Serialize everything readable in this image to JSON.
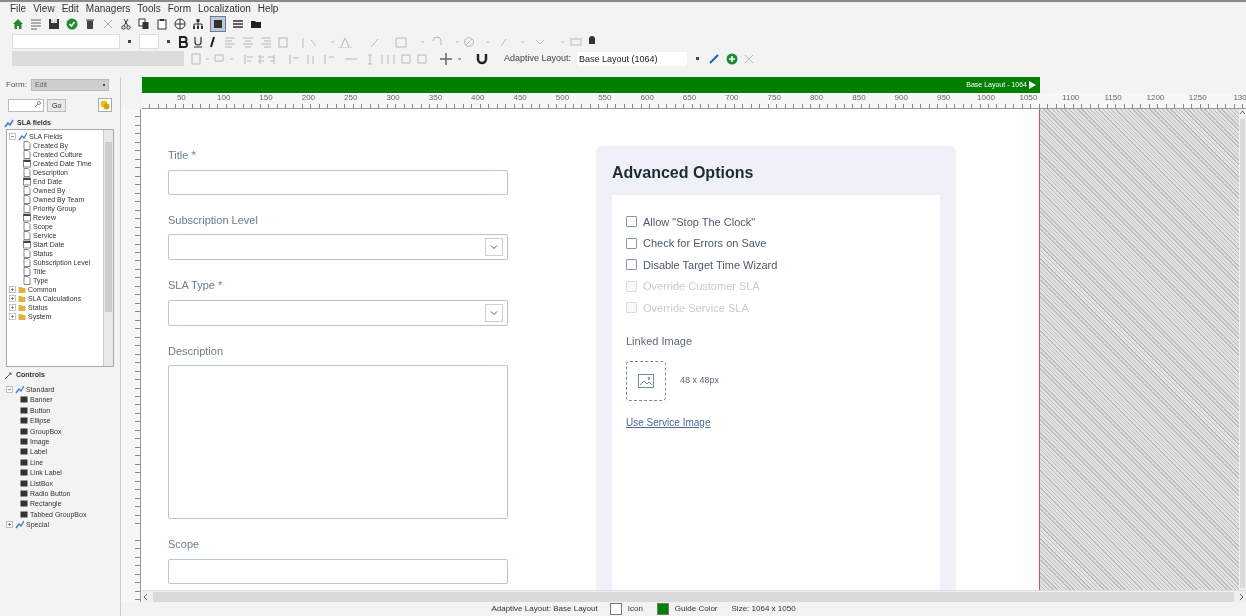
{
  "menu": [
    "File",
    "View",
    "Edit",
    "Managers",
    "Tools",
    "Form",
    "Localization",
    "Help"
  ],
  "toolbar": {
    "adaptive_layout_label": "Adaptive Layout:",
    "adaptive_layout_value": "Base Layout (1064)"
  },
  "left_panel": {
    "form_label": "Form:",
    "form_value": "Edit",
    "go_button": "Go",
    "fields_header": "SLA fields",
    "field_tree": [
      {
        "label": "SLA Fields",
        "kind": "group",
        "expanded": true,
        "children": [
          {
            "label": "Created By",
            "kind": "field"
          },
          {
            "label": "Created Culture",
            "kind": "field"
          },
          {
            "label": "Created Date Time",
            "kind": "date"
          },
          {
            "label": "Description",
            "kind": "field"
          },
          {
            "label": "End Date",
            "kind": "date"
          },
          {
            "label": "Owned By",
            "kind": "field"
          },
          {
            "label": "Owned By Team",
            "kind": "field"
          },
          {
            "label": "Priority Group",
            "kind": "field"
          },
          {
            "label": "Review",
            "kind": "date"
          },
          {
            "label": "Scope",
            "kind": "field"
          },
          {
            "label": "Service",
            "kind": "field"
          },
          {
            "label": "Start Date",
            "kind": "date"
          },
          {
            "label": "Status",
            "kind": "field"
          },
          {
            "label": "Subscription Level",
            "kind": "field"
          },
          {
            "label": "Title",
            "kind": "field"
          },
          {
            "label": "Type",
            "kind": "field"
          }
        ]
      },
      {
        "label": "Common",
        "kind": "folder",
        "expanded": false
      },
      {
        "label": "SLA Calculations",
        "kind": "folder",
        "expanded": false
      },
      {
        "label": "Status",
        "kind": "folder",
        "expanded": false
      },
      {
        "label": "System",
        "kind": "folder",
        "expanded": false
      }
    ],
    "controls_header": "Controls",
    "controls_tree": [
      {
        "label": "Standard",
        "kind": "group",
        "expanded": true,
        "children": [
          {
            "label": "Banner",
            "kind": "control"
          },
          {
            "label": "Button",
            "kind": "control"
          },
          {
            "label": "Ellipse",
            "kind": "control"
          },
          {
            "label": "GroupBox",
            "kind": "control"
          },
          {
            "label": "Image",
            "kind": "control"
          },
          {
            "label": "Label",
            "kind": "control"
          },
          {
            "label": "Line",
            "kind": "control"
          },
          {
            "label": "Link Label",
            "kind": "control"
          },
          {
            "label": "ListBox",
            "kind": "control"
          },
          {
            "label": "Radio Button",
            "kind": "control"
          },
          {
            "label": "Rectangle",
            "kind": "control"
          },
          {
            "label": "Tabbed GroupBox",
            "kind": "control"
          }
        ]
      },
      {
        "label": "Special",
        "kind": "group",
        "expanded": false
      }
    ]
  },
  "canvas": {
    "layout_banner": "Base Layout - 1064",
    "ruler_labels": [
      "50",
      "100",
      "150",
      "200",
      "250",
      "300",
      "350",
      "400",
      "450",
      "500",
      "550",
      "600",
      "650",
      "700",
      "750",
      "800",
      "850",
      "900",
      "950",
      "1000",
      "1050",
      "1100",
      "1150",
      "1200",
      "1250",
      "130"
    ],
    "form_fields": [
      {
        "label": "Title *",
        "kind": "text"
      },
      {
        "label": "Subscription Level",
        "kind": "select"
      },
      {
        "label": "SLA Type *",
        "kind": "select"
      },
      {
        "label": "Description",
        "kind": "textarea"
      },
      {
        "label": "Scope",
        "kind": "text"
      }
    ],
    "advanced_options": {
      "title": "Advanced Options",
      "options": [
        {
          "label": "Allow \"Stop The Clock\"",
          "checked": false,
          "disabled": false
        },
        {
          "label": "Check for Errors on Save",
          "checked": false,
          "disabled": false
        },
        {
          "label": "Disable Target Time Wizard",
          "checked": false,
          "disabled": false
        },
        {
          "label": "Override Customer SLA",
          "checked": false,
          "disabled": true
        },
        {
          "label": "Override Service SLA",
          "checked": false,
          "disabled": true
        }
      ],
      "linked_image_label": "Linked Image",
      "image_size": "48 x 48px",
      "link": "Use Service Image"
    }
  },
  "status_bar": {
    "layout": "Adaptive Layout: Base Layout",
    "swatches": [
      {
        "label": "Icon",
        "color": "#ffffff"
      },
      {
        "label": "Guide Color",
        "color": "#008000"
      }
    ],
    "size": "Size: 1064 x 1050"
  }
}
